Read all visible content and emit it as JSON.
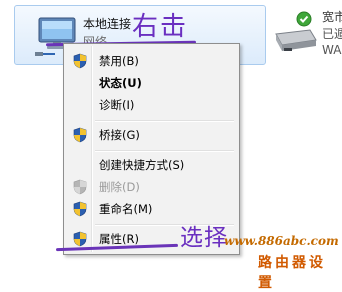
{
  "connection": {
    "name": "本地连接",
    "type": "网络",
    "icon": "network-adapter-icon"
  },
  "connection2": {
    "name_partial": "宽市",
    "status_partial": "已遁",
    "type_partial": "WA",
    "icon": "broadband-connection-icon",
    "status_icon": "green-check-icon"
  },
  "annotations": {
    "right_click": "右击",
    "select": "选择",
    "color": "#6a2fc0"
  },
  "context_menu": {
    "items": [
      {
        "label": "禁用(B)",
        "shield": true,
        "bold": false,
        "disabled": false
      },
      {
        "label": "状态(U)",
        "shield": false,
        "bold": true,
        "disabled": false
      },
      {
        "label": "诊断(I)",
        "shield": false,
        "bold": false,
        "disabled": false
      },
      {
        "label": "桥接(G)",
        "shield": true,
        "bold": false,
        "disabled": false
      },
      {
        "label": "创建快捷方式(S)",
        "shield": false,
        "bold": false,
        "disabled": false
      },
      {
        "label": "删除(D)",
        "shield": true,
        "bold": false,
        "disabled": true
      },
      {
        "label": "重命名(M)",
        "shield": true,
        "bold": false,
        "disabled": false
      },
      {
        "label": "属性(R)",
        "shield": true,
        "bold": false,
        "disabled": false
      }
    ]
  },
  "watermark": {
    "url": "www.886abc.com",
    "name": "路由器设置"
  }
}
